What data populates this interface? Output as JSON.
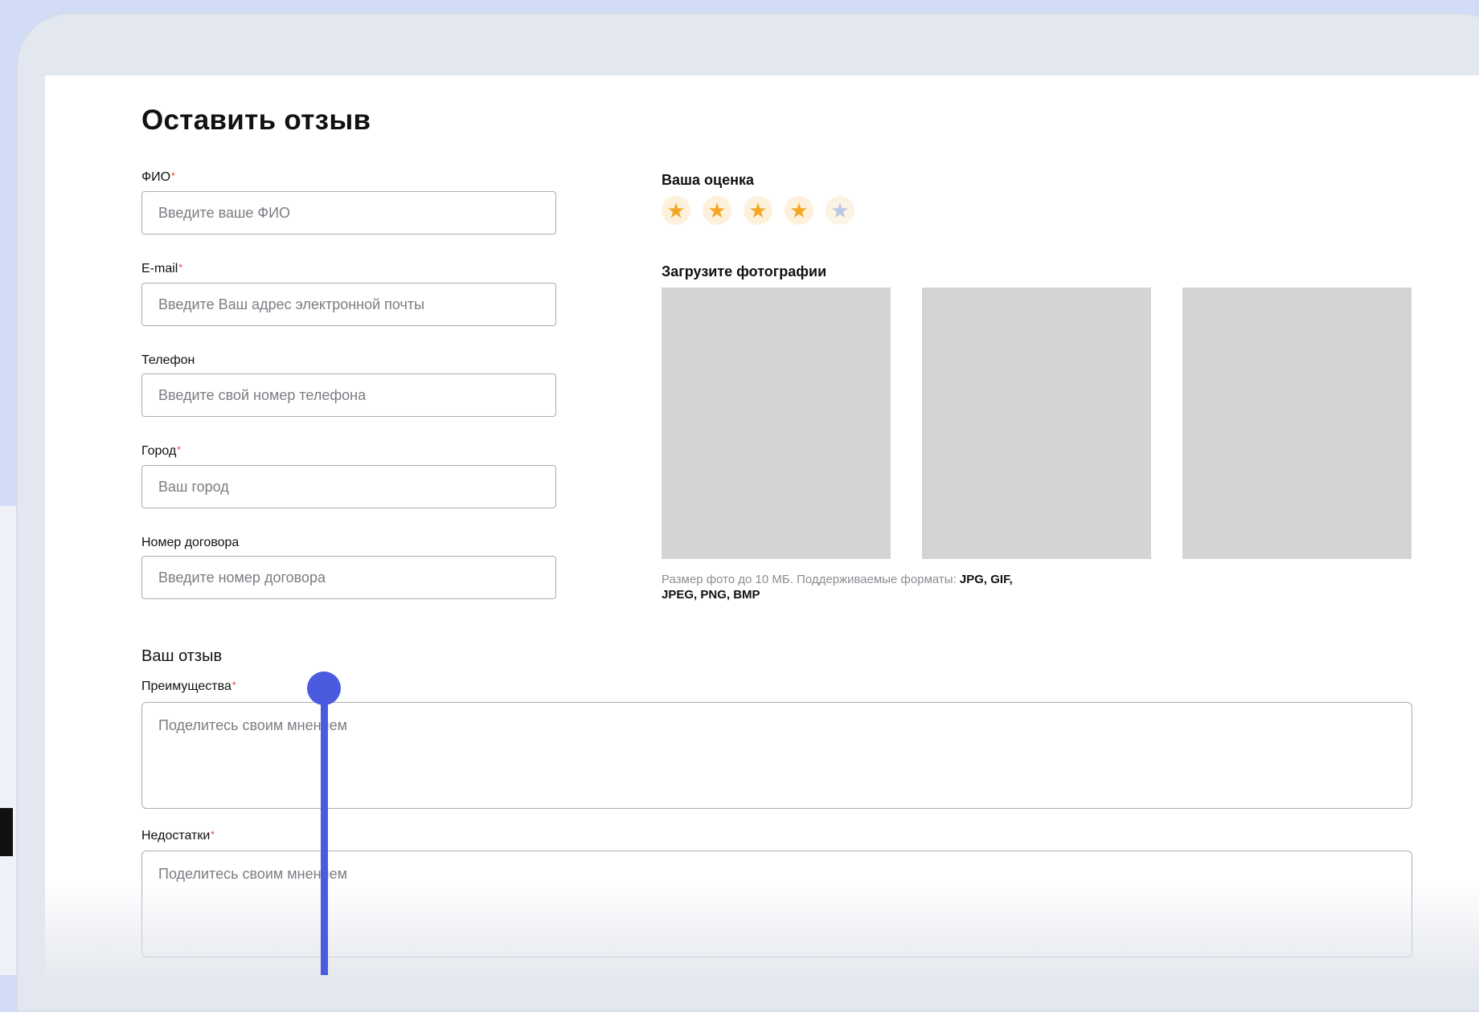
{
  "form": {
    "title": "Оставить отзыв",
    "fields": [
      {
        "label": "ФИО",
        "required": "*",
        "placeholder": "Введите ваше ФИО"
      },
      {
        "label": "E-mail",
        "required": "*",
        "placeholder": "Введите Ваш адрес электронной почты"
      },
      {
        "label": "Телефон",
        "required": "",
        "placeholder": "Введите свой номер телефона"
      },
      {
        "label": "Город",
        "required": "*",
        "placeholder": "Ваш город"
      },
      {
        "label": "Номер договора",
        "required": "",
        "placeholder": "Введите номер договора"
      }
    ],
    "rating": {
      "label": "Ваша оценка",
      "value": 4,
      "max": 5,
      "star_glyph": "★",
      "active_color": "#f5a623",
      "inactive_color": "#b8c7e4"
    },
    "photos": {
      "label": "Загрузите фотографии",
      "note_prefix": "Размер фото до 10 МБ. Поддерживаемые форматы: ",
      "formats_line1": "JPG, GIF,",
      "formats_line2": "JPEG, PNG, BMP"
    },
    "review": {
      "section_title": "Ваш отзыв",
      "advantages_label": "Преимущества",
      "advantages_required": "*",
      "advantages_placeholder": "Поделитесь своим мнением",
      "disadvantages_label": "Недостатки",
      "disadvantages_required": "*",
      "disadvantages_placeholder": "Поделитесь своим мнением"
    }
  },
  "colors": {
    "background": "#d3dcf6",
    "accent": "#4b5be0",
    "required": "#e53935"
  }
}
